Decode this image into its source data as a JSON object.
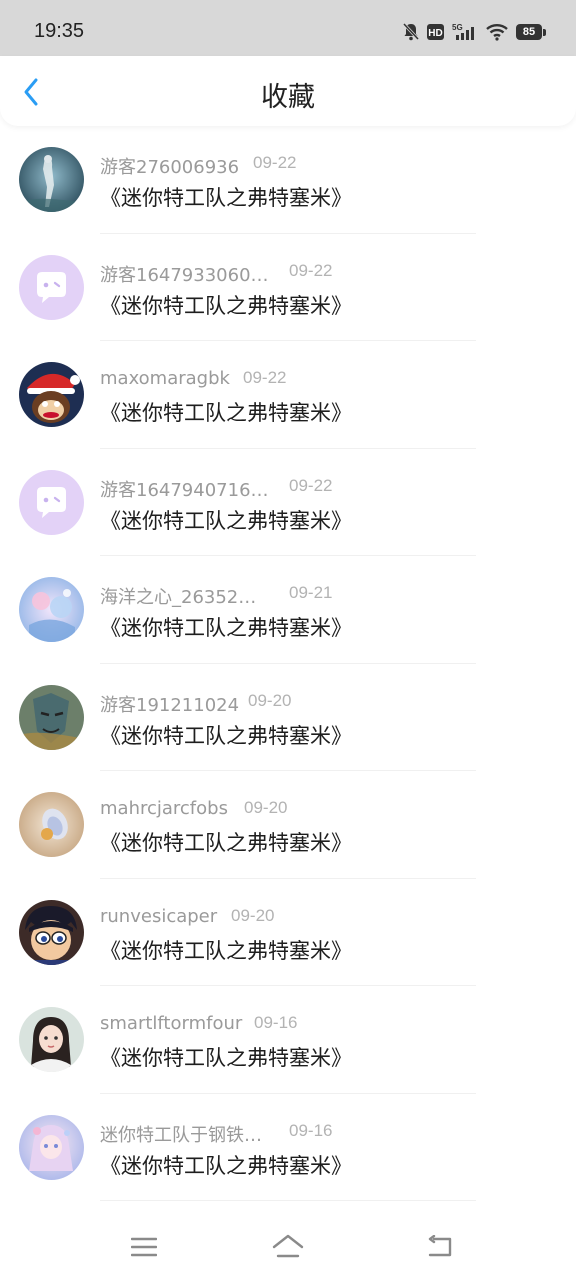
{
  "status_bar": {
    "time": "19:35",
    "battery": "85",
    "icons": [
      "mute-bell-icon",
      "hd-icon",
      "5g-signal-icon",
      "wifi-icon",
      "battery-icon"
    ]
  },
  "header": {
    "title": "收藏",
    "back_icon": "chevron-left-icon",
    "accent_color": "#2a9df4"
  },
  "items": [
    {
      "username": "游客276006936",
      "date": "09-22",
      "title": "《迷你特工队之弗特塞米》"
    },
    {
      "username": "游客1647933060…",
      "date": "09-22",
      "title": "《迷你特工队之弗特塞米》"
    },
    {
      "username": "maxomaragbk",
      "date": "09-22",
      "title": "《迷你特工队之弗特塞米》"
    },
    {
      "username": "游客1647940716…",
      "date": "09-22",
      "title": "《迷你特工队之弗特塞米》"
    },
    {
      "username": "海洋之心_26352…",
      "date": "09-21",
      "title": "《迷你特工队之弗特塞米》"
    },
    {
      "username": "游客191211024",
      "date": "09-20",
      "title": "《迷你特工队之弗特塞米》"
    },
    {
      "username": "mahrcjarcfobs",
      "date": "09-20",
      "title": "《迷你特工队之弗特塞米》"
    },
    {
      "username": "runvesicaper",
      "date": "09-20",
      "title": "《迷你特工队之弗特塞米》"
    },
    {
      "username": "smartlftormfour",
      "date": "09-16",
      "title": "《迷你特工队之弗特塞米》"
    },
    {
      "username": "迷你特工队于钢铁…",
      "date": "09-16",
      "title": "《迷你特工队之弗特塞米》"
    }
  ],
  "nav_bar": {
    "icons": [
      "menu-icon",
      "home-icon",
      "back-icon"
    ]
  }
}
